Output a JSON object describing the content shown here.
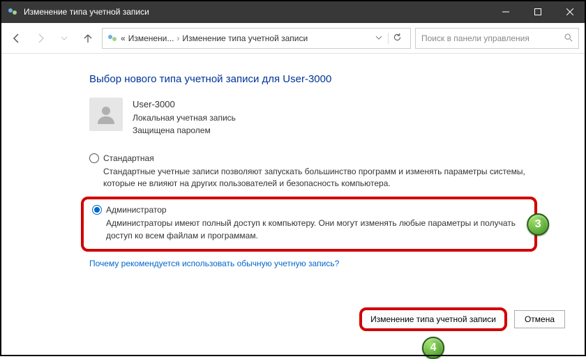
{
  "window": {
    "title": "Изменение типа учетной записи"
  },
  "nav": {
    "crumb1": "Изменени...",
    "crumb2": "Изменение типа учетной записи",
    "search_placeholder": "Поиск в панели управления"
  },
  "main": {
    "heading": "Выбор нового типа учетной записи для User-3000",
    "user": {
      "name": "User-3000",
      "line1": "Локальная учетная запись",
      "line2": "Защищена паролем"
    },
    "options": {
      "standard": {
        "label": "Стандартная",
        "desc": "Стандартные учетные записи позволяют запускать большинство программ и изменять параметры системы, которые не влияют на других пользователей и безопасность компьютера."
      },
      "admin": {
        "label": "Администратор",
        "desc": "Администраторы имеют полный доступ к компьютеру. Они могут изменять любые параметры и получать доступ ко всем файлам и программам."
      }
    },
    "link": "Почему рекомендуется использовать обычную учетную запись?"
  },
  "buttons": {
    "change": "Изменение типа учетной записи",
    "cancel": "Отмена"
  },
  "badges": {
    "b3": "3",
    "b4": "4"
  }
}
